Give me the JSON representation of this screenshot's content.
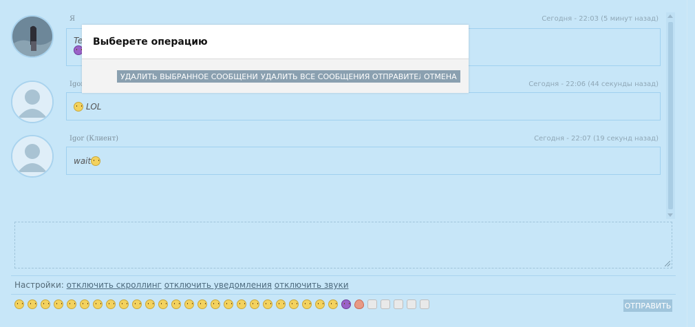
{
  "messages": [
    {
      "author": "Я",
      "timestamp": "Сегодня - 22:03 (5 минут назад)",
      "text": "Te",
      "emoji": "purple-devil-emoji"
    },
    {
      "author": "Igor",
      "timestamp": "Сегодня - 22:06 (44 секунды назад)",
      "text": "LOL",
      "emoji": "angel-emoji"
    },
    {
      "author": "Igor (Клиент)",
      "timestamp": "Сегодня - 22:07 (19 секунд назад)",
      "text": "wait",
      "emoji": "tongue-wink-emoji"
    }
  ],
  "settings": {
    "label": "Настройки:",
    "scrolling": "отключить скроллинг",
    "notifications": "отключить уведомления",
    "sounds": "отключить звуки"
  },
  "send_label": "ОТПРАВИТЬ",
  "modal": {
    "title": "Выберете операцию",
    "delete_selected": "УДАЛИТЬ ВЫБРАННОЕ СООБЩЕНИЕ",
    "delete_all": "УДАЛИТЬ ВСЕ СООБЩЕНИЯ ОТПРАВИТЕЛЯ",
    "cancel": "ОТМЕНА"
  },
  "emoji_bar": [
    "smile",
    "grin",
    "wink",
    "laugh",
    "tongue",
    "blush",
    "heart-eyes",
    "sunglasses",
    "dizzy",
    "smirk",
    "neutral",
    "sweat",
    "cry",
    "weary",
    "scream",
    "expressionless",
    "unamused",
    "angry",
    "rage",
    "angel",
    "cold-sweat",
    "astonished",
    "flushed",
    "relieved",
    "sleepy",
    "devil",
    "heart",
    "thumbs-up",
    "thumbs-down",
    "point-up",
    "victory",
    "ok-hand"
  ],
  "colors": {
    "background": "#c7e6f8",
    "border": "#9fd0ef",
    "modal_button": "#8aa0b0",
    "send_button": "#a0c5dc"
  }
}
